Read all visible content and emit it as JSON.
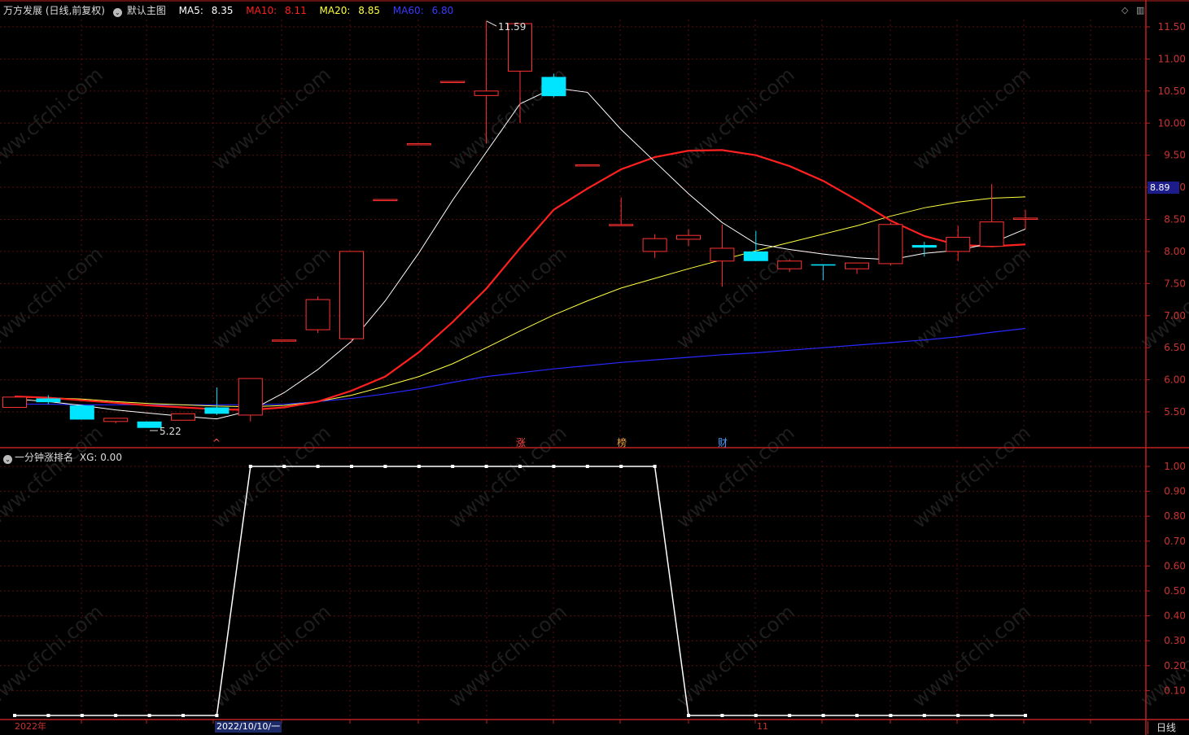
{
  "header": {
    "stock_title": "万方发展 (日线,前复权)",
    "main_chart": "默认主图",
    "ma5": {
      "label": "MA5:",
      "value": "8.35",
      "color": "#ffffff"
    },
    "ma10": {
      "label": "MA10:",
      "value": "8.11",
      "color": "#ff2020"
    },
    "ma20": {
      "label": "MA20:",
      "value": "8.85",
      "color": "#ffff40"
    },
    "ma60": {
      "label": "MA60:",
      "value": "6.80",
      "color": "#2828ff"
    }
  },
  "indicator_header": {
    "name": "一分钟涨排名",
    "xg_label": "XG:",
    "xg_value": "0.00"
  },
  "price_badge": "8.89",
  "period_label": "日线",
  "x_axis": {
    "year_label": "2022年",
    "date_cursor": "2022/10/10/一",
    "month_label": "11"
  },
  "markers": {
    "up_arrow": "^",
    "zhang": "涨",
    "bang": "榜",
    "cai": "财"
  },
  "annotations": {
    "high": "11.59",
    "low": "5.22"
  },
  "watermark": "www.cfchi.com",
  "colors": {
    "up": "#ff3232",
    "down": "#00e5ff",
    "ma5": "#ffffff",
    "ma10": "#ff2020",
    "ma20": "#ffff40",
    "ma60": "#2828ff",
    "axis": "#bb2222",
    "grid": "#5a0d0d"
  },
  "chart_data": [
    {
      "type": "candlestick",
      "title": "",
      "ylim": [
        5.0,
        11.7
      ],
      "y_ticks": [
        "5.50",
        "6.00",
        "6.50",
        "7.00",
        "7.50",
        "8.00",
        "8.50",
        "9.00",
        "9.50",
        "10.00",
        "10.50",
        "11.00",
        "11.50"
      ],
      "candles": [
        {
          "o": 5.57,
          "h": 5.73,
          "l": 5.57,
          "c": 5.73
        },
        {
          "o": 5.71,
          "h": 5.76,
          "l": 5.62,
          "c": 5.65
        },
        {
          "o": 5.6,
          "h": 5.6,
          "l": 5.38,
          "c": 5.38
        },
        {
          "o": 5.35,
          "h": 5.4,
          "l": 5.32,
          "c": 5.4
        },
        {
          "o": 5.35,
          "h": 5.35,
          "l": 5.25,
          "c": 5.25
        },
        {
          "o": 5.37,
          "h": 5.47,
          "l": 5.37,
          "c": 5.47
        },
        {
          "o": 5.57,
          "h": 5.88,
          "l": 5.45,
          "c": 5.47
        },
        {
          "o": 5.45,
          "h": 6.02,
          "l": 5.35,
          "c": 6.02
        },
        {
          "o": 6.62,
          "h": 6.62,
          "l": 6.62,
          "c": 6.62
        },
        {
          "o": 6.78,
          "h": 7.3,
          "l": 6.73,
          "c": 7.25
        },
        {
          "o": 6.64,
          "h": 8.0,
          "l": 6.58,
          "c": 8.0
        },
        {
          "o": 8.81,
          "h": 8.81,
          "l": 8.81,
          "c": 8.81
        },
        {
          "o": 9.68,
          "h": 9.68,
          "l": 9.68,
          "c": 9.68
        },
        {
          "o": 10.65,
          "h": 10.65,
          "l": 10.65,
          "c": 10.65
        },
        {
          "o": 10.43,
          "h": 11.59,
          "l": 9.68,
          "c": 10.5
        },
        {
          "o": 10.81,
          "h": 11.55,
          "l": 10.0,
          "c": 11.55
        },
        {
          "o": 10.72,
          "h": 10.77,
          "l": 10.4,
          "c": 10.42
        },
        {
          "o": 9.35,
          "h": 9.35,
          "l": 9.35,
          "c": 9.35
        },
        {
          "o": 8.42,
          "h": 8.84,
          "l": 8.42,
          "c": 8.42
        },
        {
          "o": 8.0,
          "h": 8.27,
          "l": 7.9,
          "c": 8.2
        },
        {
          "o": 8.19,
          "h": 8.35,
          "l": 8.08,
          "c": 8.25
        },
        {
          "o": 7.85,
          "h": 8.42,
          "l": 7.45,
          "c": 8.05
        },
        {
          "o": 8.0,
          "h": 8.32,
          "l": 7.85,
          "c": 7.85
        },
        {
          "o": 7.73,
          "h": 7.88,
          "l": 7.68,
          "c": 7.85
        },
        {
          "o": 7.8,
          "h": 7.8,
          "l": 7.55,
          "c": 7.78
        },
        {
          "o": 7.73,
          "h": 7.82,
          "l": 7.65,
          "c": 7.82
        },
        {
          "o": 7.81,
          "h": 8.45,
          "l": 7.78,
          "c": 8.42
        },
        {
          "o": 8.1,
          "h": 8.15,
          "l": 7.92,
          "c": 8.06
        },
        {
          "o": 8.0,
          "h": 8.4,
          "l": 7.85,
          "c": 8.22
        },
        {
          "o": 8.08,
          "h": 9.05,
          "l": 8.08,
          "c": 8.46
        },
        {
          "o": 8.5,
          "h": 8.65,
          "l": 8.35,
          "c": 8.52
        }
      ],
      "ma5": [
        5.7,
        5.66,
        5.6,
        5.53,
        5.48,
        5.43,
        5.39,
        5.52,
        5.8,
        6.16,
        6.6,
        7.23,
        7.98,
        8.8,
        9.55,
        10.3,
        10.55,
        10.48,
        9.9,
        9.4,
        8.9,
        8.45,
        8.12,
        8.03,
        7.96,
        7.9,
        7.87,
        7.97,
        8.02,
        8.13,
        8.35
      ],
      "ma10": [
        5.74,
        5.72,
        5.68,
        5.64,
        5.6,
        5.57,
        5.54,
        5.53,
        5.57,
        5.66,
        5.83,
        6.05,
        6.43,
        6.9,
        7.42,
        8.05,
        8.65,
        8.98,
        9.28,
        9.47,
        9.57,
        9.58,
        9.5,
        9.33,
        9.1,
        8.8,
        8.48,
        8.24,
        8.1,
        8.08,
        8.11
      ],
      "ma20": [
        5.73,
        5.72,
        5.7,
        5.66,
        5.63,
        5.61,
        5.59,
        5.58,
        5.6,
        5.66,
        5.76,
        5.9,
        6.05,
        6.25,
        6.5,
        6.76,
        7.01,
        7.23,
        7.43,
        7.58,
        7.73,
        7.87,
        8.01,
        8.14,
        8.27,
        8.4,
        8.55,
        8.68,
        8.77,
        8.83,
        8.85
      ],
      "ma60": [
        5.62,
        5.62,
        5.61,
        5.61,
        5.61,
        5.61,
        5.61,
        5.61,
        5.62,
        5.66,
        5.71,
        5.78,
        5.86,
        5.96,
        6.05,
        6.11,
        6.17,
        6.22,
        6.27,
        6.31,
        6.35,
        6.39,
        6.42,
        6.46,
        6.5,
        6.54,
        6.58,
        6.62,
        6.67,
        6.74,
        6.8
      ]
    },
    {
      "type": "line",
      "title": "",
      "ylim": [
        0,
        1.05
      ],
      "y_ticks": [
        "0.10",
        "0.20",
        "0.30",
        "0.40",
        "0.50",
        "0.60",
        "0.70",
        "0.80",
        "0.90",
        "1.00"
      ],
      "values": [
        0,
        0,
        0,
        0,
        0,
        0,
        0,
        1,
        1,
        1,
        1,
        1,
        1,
        1,
        1,
        1,
        1,
        1,
        1,
        1,
        0,
        0,
        0,
        0,
        0,
        0,
        0,
        0,
        0,
        0,
        0
      ]
    }
  ]
}
